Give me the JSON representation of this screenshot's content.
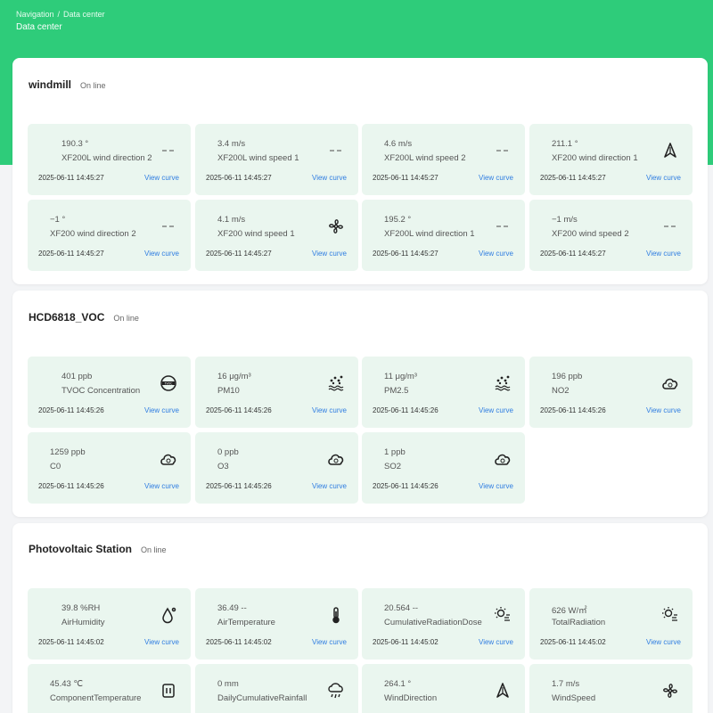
{
  "header": {
    "breadcrumb": [
      "Navigation",
      "/",
      "Data center"
    ],
    "title": "Data center",
    "color": "#2ecc7a"
  },
  "sections": [
    {
      "name": "windmill",
      "status": "On line",
      "cards": [
        {
          "value": "190.3 °",
          "name": "XF200L wind direction 2",
          "time": "2025-06-11 14:45:27",
          "link": "View curve",
          "icon": "dash"
        },
        {
          "value": "3.4 m/s",
          "name": "XF200L wind speed 1",
          "time": "2025-06-11 14:45:27",
          "link": "View curve",
          "icon": "dash"
        },
        {
          "value": "4.6 m/s",
          "name": "XF200L wind speed 2",
          "time": "2025-06-11 14:45:27",
          "link": "View curve",
          "icon": "dash"
        },
        {
          "value": "211.1 °",
          "name": "XF200 wind direction 1",
          "time": "2025-06-11 14:45:27",
          "link": "View curve",
          "icon": "compass"
        },
        {
          "value": "−1 °",
          "name": "XF200 wind direction 2",
          "time": "2025-06-11 14:45:27",
          "link": "View curve",
          "icon": "dash"
        },
        {
          "value": "4.1 m/s",
          "name": "XF200 wind speed 1",
          "time": "2025-06-11 14:45:27",
          "link": "View curve",
          "icon": "fan"
        },
        {
          "value": "195.2 °",
          "name": "XF200L wind direction 1",
          "time": "2025-06-11 14:45:27",
          "link": "View curve",
          "icon": "dash"
        },
        {
          "value": "−1 m/s",
          "name": "XF200 wind speed 2",
          "time": "2025-06-11 14:45:27",
          "link": "View curve",
          "icon": "dash"
        }
      ]
    },
    {
      "name": "HCD6818_VOC",
      "status": "On line",
      "cards": [
        {
          "value": "401 ppb",
          "name": "TVOC Concentration",
          "time": "2025-06-11 14:45:26",
          "link": "View curve",
          "icon": "tvoc"
        },
        {
          "value": "16 μg/m³",
          "name": "PM10",
          "time": "2025-06-11 14:45:26",
          "link": "View curve",
          "icon": "pm"
        },
        {
          "value": "11 μg/m³",
          "name": "PM2.5",
          "time": "2025-06-11 14:45:26",
          "link": "View curve",
          "icon": "pm"
        },
        {
          "value": "196 ppb",
          "name": "NO2",
          "time": "2025-06-11 14:45:26",
          "link": "View curve",
          "icon": "cloud"
        },
        {
          "value": "1259 ppb",
          "name": "C0",
          "time": "2025-06-11 14:45:26",
          "link": "View curve",
          "icon": "cloud"
        },
        {
          "value": "0 ppb",
          "name": "O3",
          "time": "2025-06-11 14:45:26",
          "link": "View curve",
          "icon": "cloud"
        },
        {
          "value": "1 ppb",
          "name": "SO2",
          "time": "2025-06-11 14:45:26",
          "link": "View curve",
          "icon": "cloud"
        }
      ]
    },
    {
      "name": "Photovoltaic Station",
      "status": "On line",
      "cards": [
        {
          "value": "39.8 %RH",
          "name": "AirHumidity",
          "time": "2025-06-11 14:45:02",
          "link": "View curve",
          "icon": "droplet"
        },
        {
          "value": "36.49 --",
          "name": "AirTemperature",
          "time": "2025-06-11 14:45:02",
          "link": "View curve",
          "icon": "thermometer"
        },
        {
          "value": "20.564 --",
          "name": "CumulativeRadiationDose",
          "time": "2025-06-11 14:45:02",
          "link": "View curve",
          "icon": "sun"
        },
        {
          "value": "626 W/㎡",
          "name": "TotalRadiation",
          "time": "2025-06-11 14:45:02",
          "link": "View curve",
          "icon": "sun"
        },
        {
          "value": "45.43 ℃",
          "name": "ComponentTemperature",
          "time": "",
          "link": "",
          "icon": "battery"
        },
        {
          "value": "0 mm",
          "name": "DailyCumulativeRainfall",
          "time": "",
          "link": "",
          "icon": "rain"
        },
        {
          "value": "264.1 °",
          "name": "WindDirection",
          "time": "",
          "link": "",
          "icon": "compass"
        },
        {
          "value": "1.7 m/s",
          "name": "WindSpeed",
          "time": "",
          "link": "",
          "icon": "fan"
        }
      ]
    }
  ]
}
